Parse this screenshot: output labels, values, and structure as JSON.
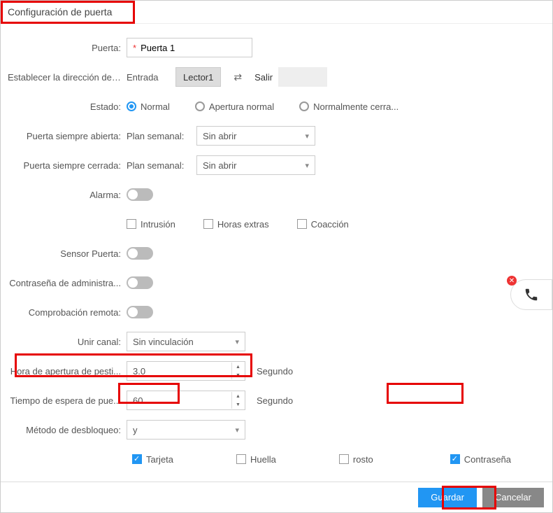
{
  "title": "Configuración de puerta",
  "labels": {
    "puerta": "Puerta:",
    "direccion": "Establecer la dirección del...",
    "estado": "Estado:",
    "siempre_abierta": "Puerta siempre abierta:",
    "siempre_cerrada": "Puerta siempre cerrada:",
    "alarma": "Alarma:",
    "sensor": "Sensor Puerta:",
    "admin_pass": "Contraseña de administra...",
    "remota": "Comprobación remota:",
    "unir_canal": "Unir canal:",
    "apertura": "Hora de apertura de pesti...",
    "espera": "Tiempo de espera de pue...",
    "metodo": "Método de desbloqueo:"
  },
  "puerta_value": "Puerta 1",
  "direccion": {
    "entrada": "Entrada",
    "lector1": "Lector1",
    "salir": "Salir"
  },
  "estado": {
    "normal": "Normal",
    "apertura": "Apertura normal",
    "cerrada": "Normalmente cerra..."
  },
  "plan_label": "Plan semanal:",
  "plan_value": "Sin abrir",
  "alarm_opts": {
    "intrusion": "Intrusión",
    "extras": "Horas extras",
    "coaccion": "Coacción"
  },
  "unir_value": "Sin vinculación",
  "apertura_value": "3.0",
  "espera_value": "60",
  "segundo": "Segundo",
  "metodo_value": "y",
  "unlock": {
    "tarjeta": "Tarjeta",
    "huella": "Huella",
    "rosto": "rosto",
    "contrasena": "Contraseña"
  },
  "buttons": {
    "guardar": "Guardar",
    "cancelar": "Cancelar"
  }
}
